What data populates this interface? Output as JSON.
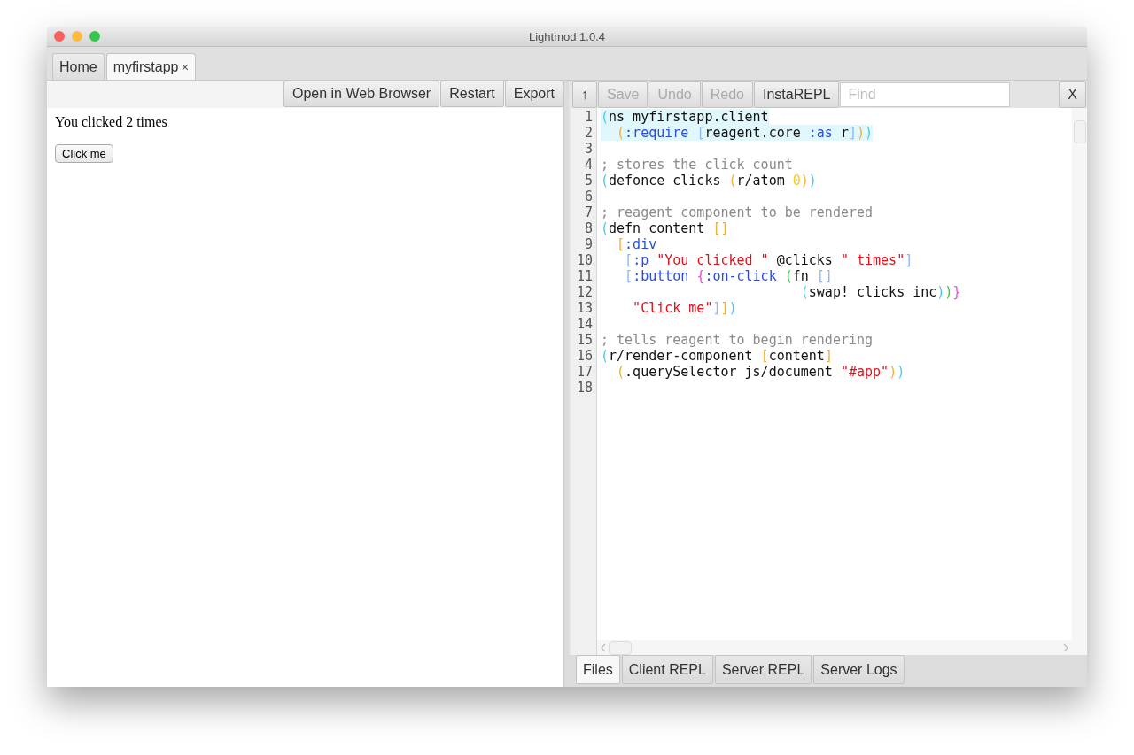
{
  "window": {
    "title": "Lightmod 1.0.4"
  },
  "tabs": [
    {
      "label": "Home",
      "selected": false
    },
    {
      "label": "myfirstapp",
      "selected": true,
      "close": "×"
    }
  ],
  "preview": {
    "toolbar": [
      "Open in Web Browser",
      "Restart",
      "Export"
    ],
    "text": "You clicked 2 times",
    "button": "Click me"
  },
  "editor_toolbar": {
    "buttons": [
      {
        "label": "↑",
        "disabled": false
      },
      {
        "label": "Save",
        "disabled": true
      },
      {
        "label": "Undo",
        "disabled": true
      },
      {
        "label": "Redo",
        "disabled": true
      },
      {
        "label": "InstaREPL",
        "disabled": false
      }
    ],
    "find": {
      "placeholder": "Find"
    },
    "close": "X"
  },
  "code": [
    {
      "number": "1",
      "highlighted": true,
      "tokens": [
        {
          "text": "(",
          "kind": "bracket",
          "color": "#4cc9ee"
        },
        {
          "text": "ns myfirstapp.client",
          "kind": "plain"
        }
      ]
    },
    {
      "number": "2",
      "highlighted": true,
      "tokens": [
        {
          "text": "  (",
          "kind": "bracket",
          "color": "#f0b03c"
        },
        {
          "text": ":require ",
          "kind": "keyword"
        },
        {
          "text": "[",
          "kind": "bracket",
          "color": "#8fb6f2"
        },
        {
          "text": "reagent.core ",
          "kind": "plain"
        },
        {
          "text": ":as",
          "kind": "keyword"
        },
        {
          "text": " r",
          "kind": "plain"
        },
        {
          "text": "]",
          "kind": "bracket",
          "color": "#8fb6f2"
        },
        {
          "text": ")",
          "kind": "bracket",
          "color": "#f0b03c"
        },
        {
          "text": ")",
          "kind": "bracket",
          "color": "#4cc9ee"
        }
      ]
    },
    {
      "number": "3",
      "highlighted": false
    },
    {
      "number": "4",
      "highlighted": false,
      "tokens": [
        {
          "text": "; stores the click count",
          "kind": "comment"
        }
      ]
    },
    {
      "number": "5",
      "highlighted": false,
      "tokens": [
        {
          "text": "(",
          "kind": "bracket",
          "color": "#4cc9ee"
        },
        {
          "text": "defonce clicks ",
          "kind": "plain"
        },
        {
          "text": "(",
          "kind": "bracket",
          "color": "#f0b03c"
        },
        {
          "text": "r/atom ",
          "kind": "plain"
        },
        {
          "text": "0",
          "kind": "number"
        },
        {
          "text": ")",
          "kind": "bracket",
          "color": "#f0b03c"
        },
        {
          "text": ")",
          "kind": "bracket",
          "color": "#4cc9ee"
        }
      ]
    },
    {
      "number": "6",
      "highlighted": false
    },
    {
      "number": "7",
      "highlighted": false,
      "tokens": [
        {
          "text": "; reagent component to be rendered",
          "kind": "comment"
        }
      ]
    },
    {
      "number": "8",
      "highlighted": false,
      "tokens": [
        {
          "text": "(",
          "kind": "bracket",
          "color": "#4cc9ee"
        },
        {
          "text": "defn content ",
          "kind": "plain"
        },
        {
          "text": "[]",
          "kind": "bracket",
          "color": "#f0b03c"
        }
      ]
    },
    {
      "number": "9",
      "highlighted": false,
      "tokens": [
        {
          "text": "  [",
          "kind": "bracket",
          "color": "#f0b03c"
        },
        {
          "text": ":div",
          "kind": "keyword"
        }
      ]
    },
    {
      "number": "10",
      "highlighted": false,
      "tokens": [
        {
          "text": "   [",
          "kind": "bracket",
          "color": "#8fb6f2"
        },
        {
          "text": ":p ",
          "kind": "keyword"
        },
        {
          "text": "\"You clicked \"",
          "kind": "string"
        },
        {
          "text": " @clicks ",
          "kind": "plain"
        },
        {
          "text": "\" times\"",
          "kind": "string"
        },
        {
          "text": "]",
          "kind": "bracket",
          "color": "#8fb6f2"
        }
      ]
    },
    {
      "number": "11",
      "highlighted": false,
      "tokens": [
        {
          "text": "   [",
          "kind": "bracket",
          "color": "#8fb6f2"
        },
        {
          "text": ":button ",
          "kind": "keyword"
        },
        {
          "text": "{",
          "kind": "bracket",
          "color": "#e84ce0"
        },
        {
          "text": ":on-click ",
          "kind": "keyword"
        },
        {
          "text": "(",
          "kind": "bracket",
          "color": "#3fc24a"
        },
        {
          "text": "fn ",
          "kind": "plain"
        },
        {
          "text": "[]",
          "kind": "bracket",
          "color": "#8fb6f2"
        }
      ]
    },
    {
      "number": "12",
      "highlighted": false,
      "tokens": [
        {
          "text": "                         (",
          "kind": "bracket",
          "color": "#4cc9ee"
        },
        {
          "text": "swap! clicks inc",
          "kind": "plain"
        },
        {
          "text": ")",
          "kind": "bracket",
          "color": "#4cc9ee"
        },
        {
          "text": ")",
          "kind": "bracket",
          "color": "#3fc24a"
        },
        {
          "text": "}",
          "kind": "bracket",
          "color": "#e84ce0"
        }
      ]
    },
    {
      "number": "13",
      "highlighted": false,
      "tokens": [
        {
          "text": "    \"Click me\"",
          "kind": "string"
        },
        {
          "text": "]",
          "kind": "bracket",
          "color": "#8fb6f2"
        },
        {
          "text": "]",
          "kind": "bracket",
          "color": "#f0b03c"
        },
        {
          "text": ")",
          "kind": "bracket",
          "color": "#4cc9ee"
        }
      ]
    },
    {
      "number": "14",
      "highlighted": false
    },
    {
      "number": "15",
      "highlighted": false,
      "tokens": [
        {
          "text": "; tells reagent to begin rendering",
          "kind": "comment"
        }
      ]
    },
    {
      "number": "16",
      "highlighted": false,
      "tokens": [
        {
          "text": "(",
          "kind": "bracket",
          "color": "#4cc9ee"
        },
        {
          "text": "r/render-component ",
          "kind": "plain"
        },
        {
          "text": "[",
          "kind": "bracket",
          "color": "#f0b03c"
        },
        {
          "text": "content",
          "kind": "plain"
        },
        {
          "text": "]",
          "kind": "bracket",
          "color": "#f0b03c"
        }
      ]
    },
    {
      "number": "17",
      "highlighted": false,
      "tokens": [
        {
          "text": "  (",
          "kind": "bracket",
          "color": "#f0b03c"
        },
        {
          "text": ".querySelector js/document ",
          "kind": "plain"
        },
        {
          "text": "\"#app\"",
          "kind": "string"
        },
        {
          "text": ")",
          "kind": "bracket",
          "color": "#f0b03c"
        },
        {
          "text": ")",
          "kind": "bracket",
          "color": "#4cc9ee"
        }
      ]
    },
    {
      "number": "18",
      "highlighted": false
    }
  ],
  "bottom_tabs": [
    {
      "label": "Files",
      "selected": true
    },
    {
      "label": "Client REPL",
      "selected": false
    },
    {
      "label": "Server REPL",
      "selected": false
    },
    {
      "label": "Server Logs",
      "selected": false
    }
  ]
}
